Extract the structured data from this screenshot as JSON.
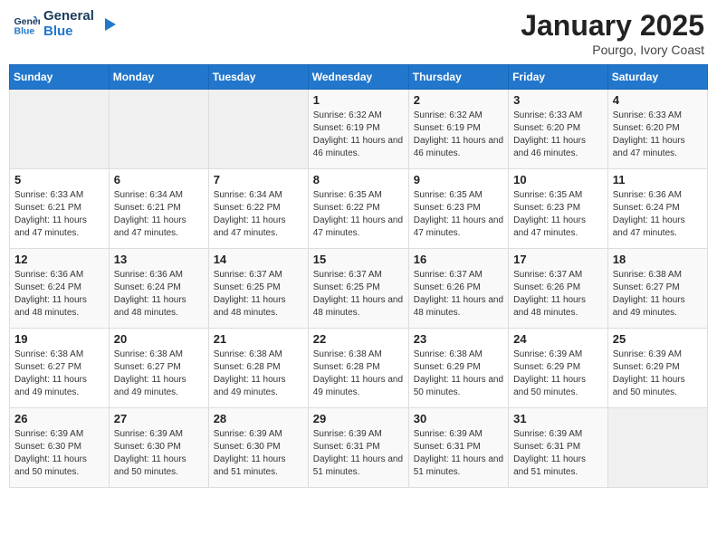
{
  "header": {
    "logo_line1": "General",
    "logo_line2": "Blue",
    "month_title": "January 2025",
    "subtitle": "Pourgo, Ivory Coast"
  },
  "weekdays": [
    "Sunday",
    "Monday",
    "Tuesday",
    "Wednesday",
    "Thursday",
    "Friday",
    "Saturday"
  ],
  "weeks": [
    [
      {
        "day": "",
        "empty": true
      },
      {
        "day": "",
        "empty": true
      },
      {
        "day": "",
        "empty": true
      },
      {
        "day": "1",
        "sunrise": "6:32 AM",
        "sunset": "6:19 PM",
        "daylight": "11 hours and 46 minutes."
      },
      {
        "day": "2",
        "sunrise": "6:32 AM",
        "sunset": "6:19 PM",
        "daylight": "11 hours and 46 minutes."
      },
      {
        "day": "3",
        "sunrise": "6:33 AM",
        "sunset": "6:20 PM",
        "daylight": "11 hours and 46 minutes."
      },
      {
        "day": "4",
        "sunrise": "6:33 AM",
        "sunset": "6:20 PM",
        "daylight": "11 hours and 47 minutes."
      }
    ],
    [
      {
        "day": "5",
        "sunrise": "6:33 AM",
        "sunset": "6:21 PM",
        "daylight": "11 hours and 47 minutes."
      },
      {
        "day": "6",
        "sunrise": "6:34 AM",
        "sunset": "6:21 PM",
        "daylight": "11 hours and 47 minutes."
      },
      {
        "day": "7",
        "sunrise": "6:34 AM",
        "sunset": "6:22 PM",
        "daylight": "11 hours and 47 minutes."
      },
      {
        "day": "8",
        "sunrise": "6:35 AM",
        "sunset": "6:22 PM",
        "daylight": "11 hours and 47 minutes."
      },
      {
        "day": "9",
        "sunrise": "6:35 AM",
        "sunset": "6:23 PM",
        "daylight": "11 hours and 47 minutes."
      },
      {
        "day": "10",
        "sunrise": "6:35 AM",
        "sunset": "6:23 PM",
        "daylight": "11 hours and 47 minutes."
      },
      {
        "day": "11",
        "sunrise": "6:36 AM",
        "sunset": "6:24 PM",
        "daylight": "11 hours and 47 minutes."
      }
    ],
    [
      {
        "day": "12",
        "sunrise": "6:36 AM",
        "sunset": "6:24 PM",
        "daylight": "11 hours and 48 minutes."
      },
      {
        "day": "13",
        "sunrise": "6:36 AM",
        "sunset": "6:24 PM",
        "daylight": "11 hours and 48 minutes."
      },
      {
        "day": "14",
        "sunrise": "6:37 AM",
        "sunset": "6:25 PM",
        "daylight": "11 hours and 48 minutes."
      },
      {
        "day": "15",
        "sunrise": "6:37 AM",
        "sunset": "6:25 PM",
        "daylight": "11 hours and 48 minutes."
      },
      {
        "day": "16",
        "sunrise": "6:37 AM",
        "sunset": "6:26 PM",
        "daylight": "11 hours and 48 minutes."
      },
      {
        "day": "17",
        "sunrise": "6:37 AM",
        "sunset": "6:26 PM",
        "daylight": "11 hours and 48 minutes."
      },
      {
        "day": "18",
        "sunrise": "6:38 AM",
        "sunset": "6:27 PM",
        "daylight": "11 hours and 49 minutes."
      }
    ],
    [
      {
        "day": "19",
        "sunrise": "6:38 AM",
        "sunset": "6:27 PM",
        "daylight": "11 hours and 49 minutes."
      },
      {
        "day": "20",
        "sunrise": "6:38 AM",
        "sunset": "6:27 PM",
        "daylight": "11 hours and 49 minutes."
      },
      {
        "day": "21",
        "sunrise": "6:38 AM",
        "sunset": "6:28 PM",
        "daylight": "11 hours and 49 minutes."
      },
      {
        "day": "22",
        "sunrise": "6:38 AM",
        "sunset": "6:28 PM",
        "daylight": "11 hours and 49 minutes."
      },
      {
        "day": "23",
        "sunrise": "6:38 AM",
        "sunset": "6:29 PM",
        "daylight": "11 hours and 50 minutes."
      },
      {
        "day": "24",
        "sunrise": "6:39 AM",
        "sunset": "6:29 PM",
        "daylight": "11 hours and 50 minutes."
      },
      {
        "day": "25",
        "sunrise": "6:39 AM",
        "sunset": "6:29 PM",
        "daylight": "11 hours and 50 minutes."
      }
    ],
    [
      {
        "day": "26",
        "sunrise": "6:39 AM",
        "sunset": "6:30 PM",
        "daylight": "11 hours and 50 minutes."
      },
      {
        "day": "27",
        "sunrise": "6:39 AM",
        "sunset": "6:30 PM",
        "daylight": "11 hours and 50 minutes."
      },
      {
        "day": "28",
        "sunrise": "6:39 AM",
        "sunset": "6:30 PM",
        "daylight": "11 hours and 51 minutes."
      },
      {
        "day": "29",
        "sunrise": "6:39 AM",
        "sunset": "6:31 PM",
        "daylight": "11 hours and 51 minutes."
      },
      {
        "day": "30",
        "sunrise": "6:39 AM",
        "sunset": "6:31 PM",
        "daylight": "11 hours and 51 minutes."
      },
      {
        "day": "31",
        "sunrise": "6:39 AM",
        "sunset": "6:31 PM",
        "daylight": "11 hours and 51 minutes."
      },
      {
        "day": "",
        "empty": true
      }
    ]
  ],
  "labels": {
    "sunrise": "Sunrise:",
    "sunset": "Sunset:",
    "daylight": "Daylight:"
  }
}
